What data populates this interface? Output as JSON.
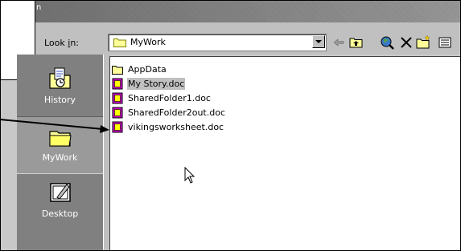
{
  "window": {
    "title": "n"
  },
  "toolbar": {
    "lookin_label_pre": "Look ",
    "lookin_label_accel": "i",
    "lookin_label_post": "n:",
    "current_folder": "MyWork"
  },
  "places": [
    {
      "label": "History",
      "icon": "history-folder-icon"
    },
    {
      "label": "MyWork",
      "icon": "mywork-folder-icon"
    },
    {
      "label": "Desktop",
      "icon": "desktop-icon"
    }
  ],
  "files": [
    {
      "name": "AppData",
      "type": "folder"
    },
    {
      "name": "My Story.doc",
      "type": "doc"
    },
    {
      "name": "SharedFolder1.doc",
      "type": "doc"
    },
    {
      "name": "SharedFolder2out.doc",
      "type": "doc"
    },
    {
      "name": "vikingsworksheet.doc",
      "type": "doc"
    }
  ],
  "colors": {
    "doc_icon": "#cc00cc",
    "folder_icon": "#ffff99",
    "places_bg": "#808080"
  }
}
